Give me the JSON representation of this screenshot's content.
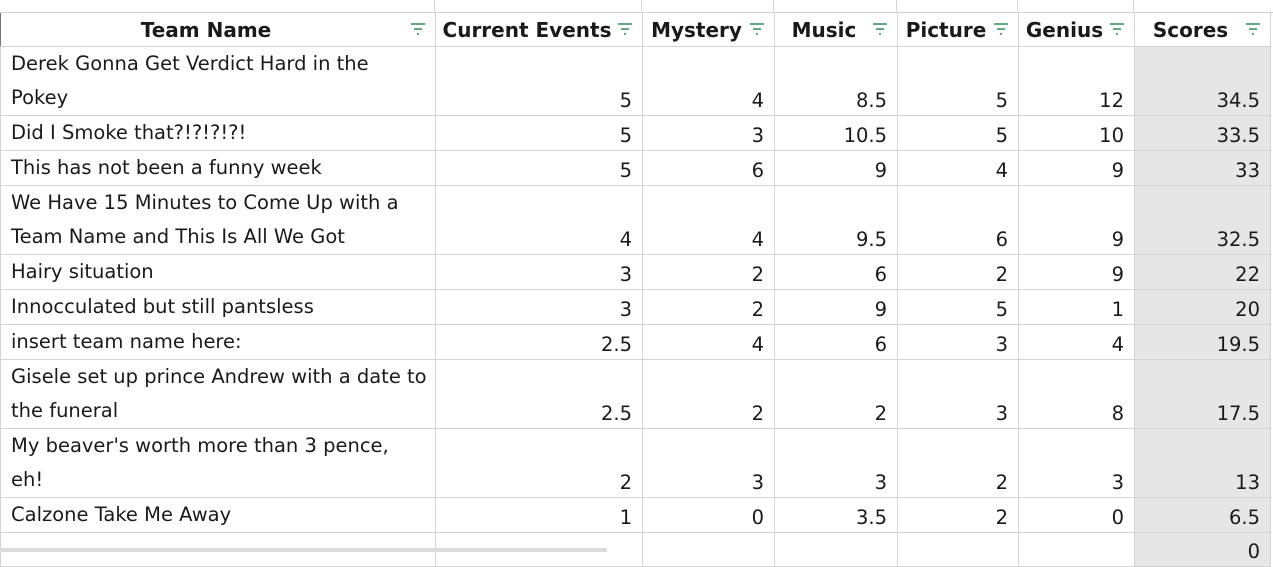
{
  "headers": {
    "team_name": "Team Name",
    "current_events": "Current Events",
    "mystery": "Mystery",
    "music": "Music",
    "picture": "Picture",
    "genius": "Genius",
    "scores": "Scores"
  },
  "filter_icon": "filter-funnel-icon",
  "colors": {
    "filter_icon": "#2e8b57",
    "score_column": "#e6e6e6",
    "grid": "#d4d4d4"
  },
  "rows": [
    {
      "name": "Derek Gonna Get Verdict Hard in the Pokey",
      "current_events": "5",
      "mystery": "4",
      "music": "8.5",
      "picture": "5",
      "genius": "12",
      "scores": "34.5"
    },
    {
      "name": "Did I Smoke that?!?!?!?!",
      "current_events": "5",
      "mystery": "3",
      "music": "10.5",
      "picture": "5",
      "genius": "10",
      "scores": "33.5"
    },
    {
      "name": "This has not been a funny week",
      "current_events": "5",
      "mystery": "6",
      "music": "9",
      "picture": "4",
      "genius": "9",
      "scores": "33"
    },
    {
      "name": "We Have 15 Minutes to Come Up with a Team Name and This Is All We Got",
      "current_events": "4",
      "mystery": "4",
      "music": "9.5",
      "picture": "6",
      "genius": "9",
      "scores": "32.5"
    },
    {
      "name": "Hairy situation",
      "current_events": "3",
      "mystery": "2",
      "music": "6",
      "picture": "2",
      "genius": "9",
      "scores": "22"
    },
    {
      "name": "Innocculated but still pantsless",
      "current_events": "3",
      "mystery": "2",
      "music": "9",
      "picture": "5",
      "genius": "1",
      "scores": "20"
    },
    {
      "name": "insert team name here:",
      "current_events": "2.5",
      "mystery": "4",
      "music": "6",
      "picture": "3",
      "genius": "4",
      "scores": "19.5"
    },
    {
      "name": "Gisele set up prince Andrew with a date to the funeral",
      "current_events": "2.5",
      "mystery": "2",
      "music": "2",
      "picture": "3",
      "genius": "8",
      "scores": "17.5"
    },
    {
      "name": "My beaver's worth more than 3 pence, eh!",
      "current_events": "2",
      "mystery": "3",
      "music": "3",
      "picture": "2",
      "genius": "3",
      "scores": "13"
    },
    {
      "name": "Calzone Take Me Away",
      "current_events": "1",
      "mystery": "0",
      "music": "3.5",
      "picture": "2",
      "genius": "0",
      "scores": "6.5"
    },
    {
      "name": "",
      "current_events": "",
      "mystery": "",
      "music": "",
      "picture": "",
      "genius": "",
      "scores": "0"
    }
  ]
}
